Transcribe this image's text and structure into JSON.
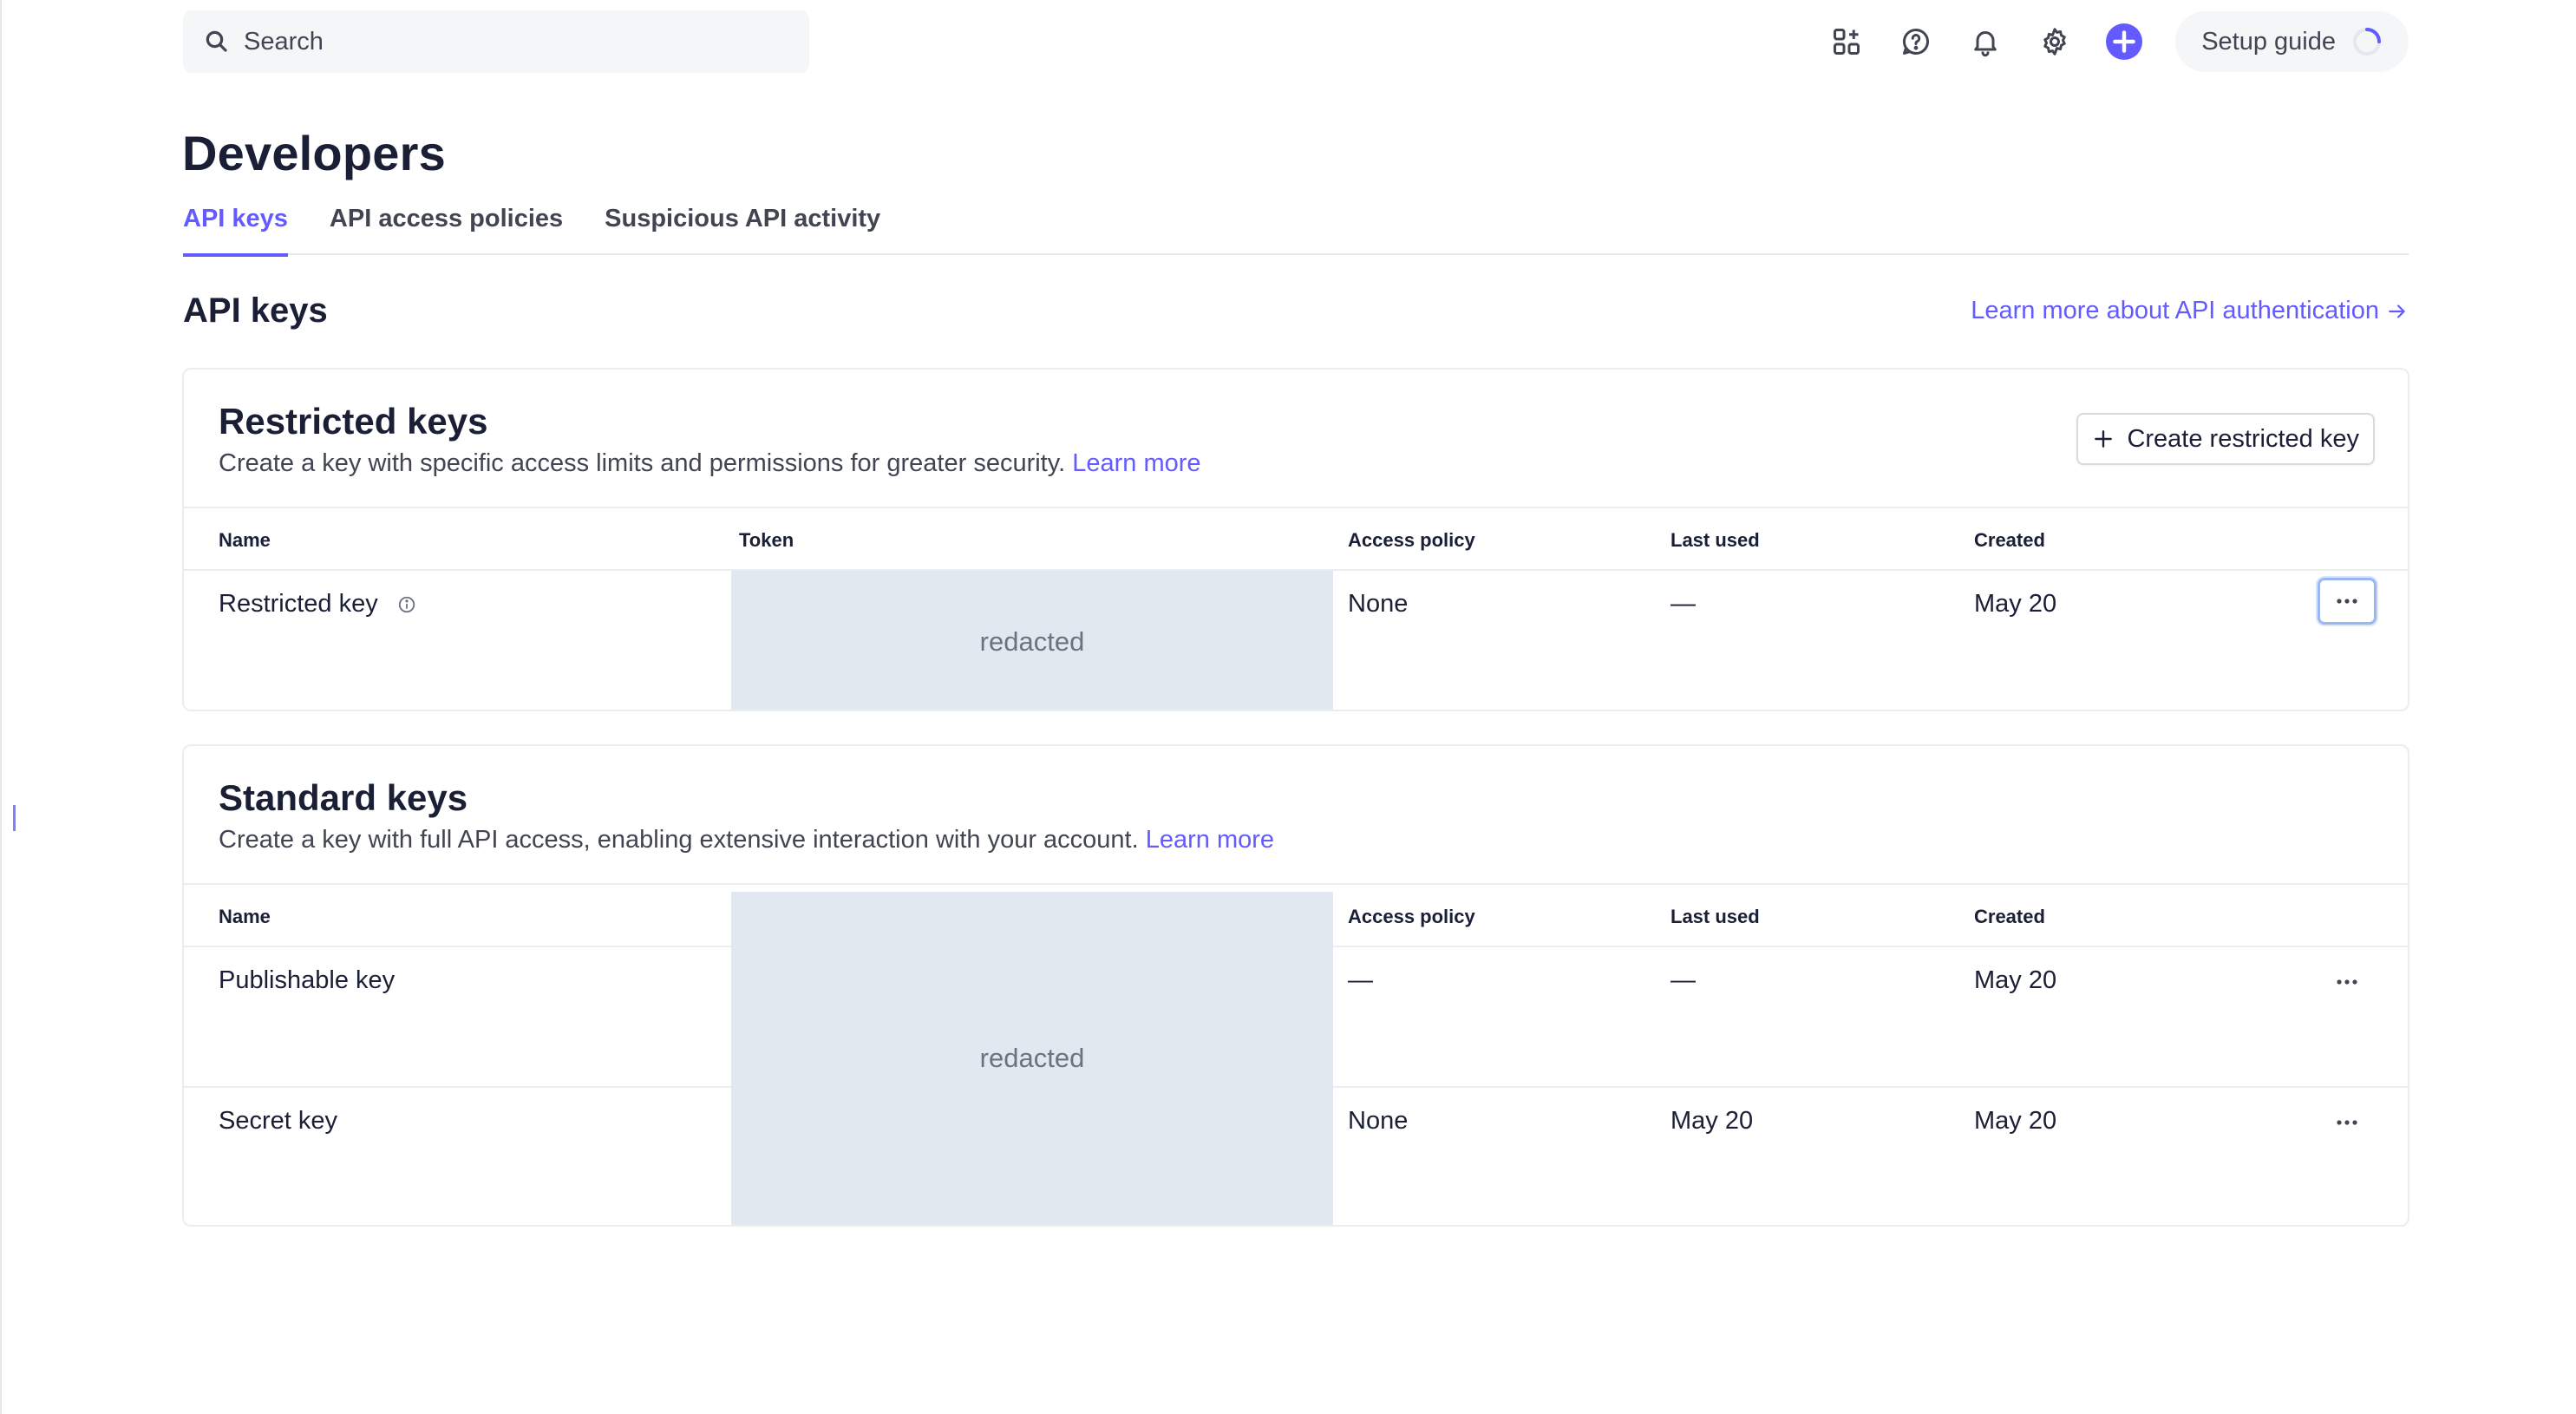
{
  "search": {
    "placeholder": "Search"
  },
  "header": {
    "setup_guide": "Setup guide"
  },
  "page": {
    "title": "Developers"
  },
  "tabs": [
    {
      "label": "API keys",
      "active": true
    },
    {
      "label": "API access policies",
      "active": false
    },
    {
      "label": "Suspicious API activity",
      "active": false
    }
  ],
  "section": {
    "title": "API keys",
    "learn_link": "Learn more about API authentication"
  },
  "restricted": {
    "title": "Restricted keys",
    "description": "Create a key with specific access limits and permissions for greater security.",
    "learn_more": "Learn more",
    "create_button": "Create restricted key",
    "columns": {
      "name": "Name",
      "token": "Token",
      "policy": "Access policy",
      "last_used": "Last used",
      "created": "Created"
    },
    "rows": [
      {
        "name": "Restricted key",
        "policy": "None",
        "last_used": "—",
        "created": "May 20"
      }
    ],
    "redacted": "redacted"
  },
  "standard": {
    "title": "Standard keys",
    "description": "Create a key with full API access, enabling extensive interaction with your account.",
    "learn_more": "Learn more",
    "columns": {
      "name": "Name",
      "policy": "Access policy",
      "last_used": "Last used",
      "created": "Created"
    },
    "rows": [
      {
        "name": "Publishable key",
        "policy": "—",
        "last_used": "—",
        "created": "May 20"
      },
      {
        "name": "Secret key",
        "policy": "None",
        "last_used": "May 20",
        "created": "May 20"
      }
    ],
    "redacted": "redacted"
  },
  "colors": {
    "accent": "#635bff",
    "redacted_bg": "#e2e8f0",
    "border": "#ebeef1"
  }
}
